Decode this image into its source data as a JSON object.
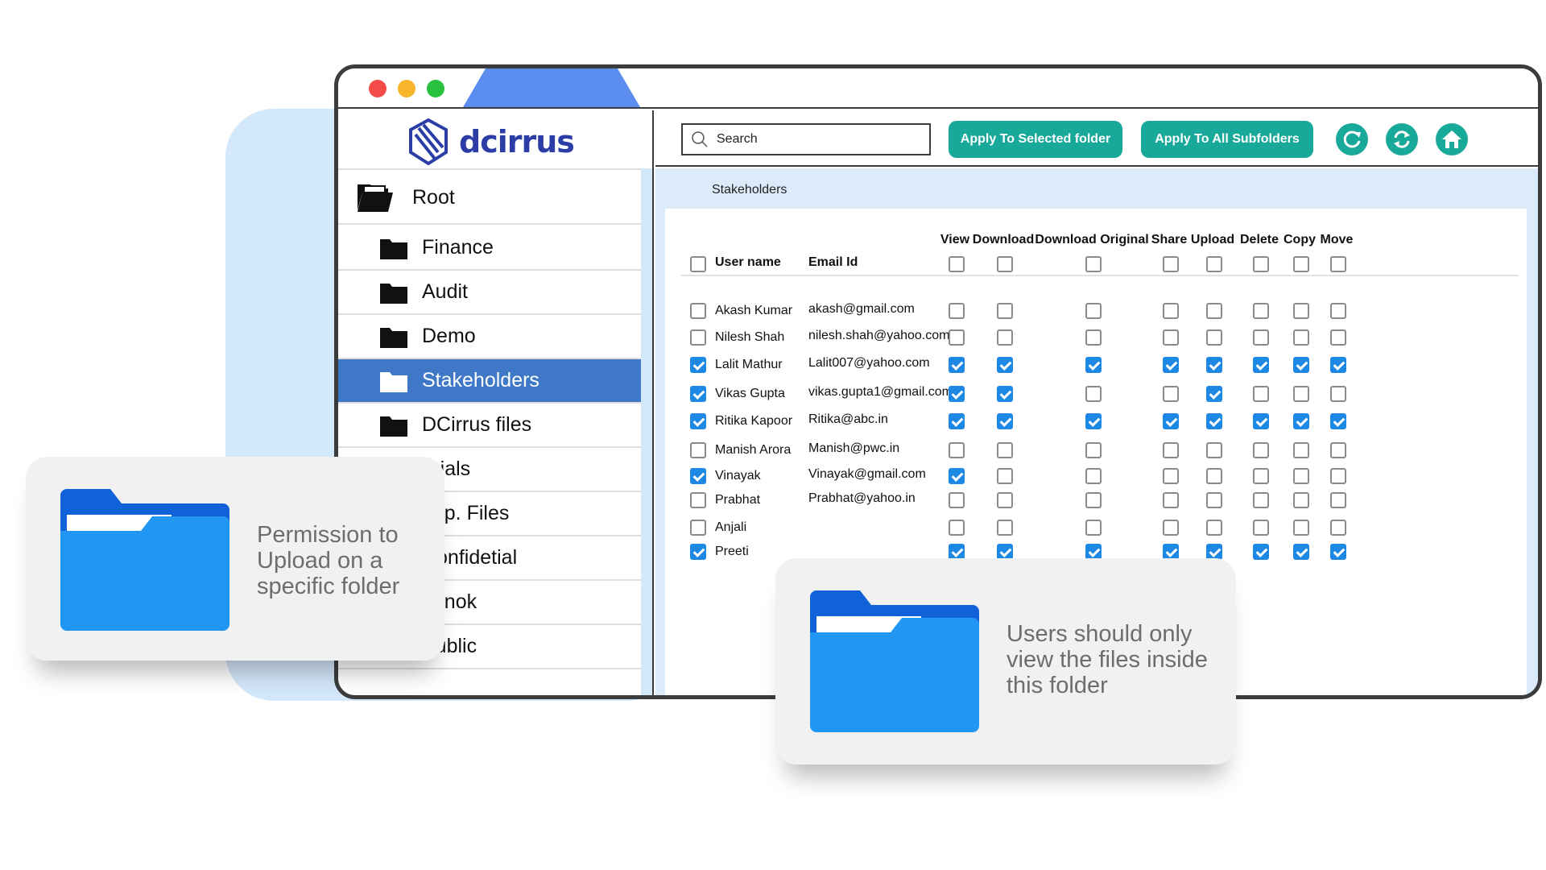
{
  "app": {
    "logo_text": "dcirrus"
  },
  "sidebar": {
    "root_label": "Root",
    "folders": [
      {
        "label": "Finance",
        "active": false
      },
      {
        "label": "Audit",
        "active": false
      },
      {
        "label": "Demo",
        "active": false
      },
      {
        "label": "Stakeholders",
        "active": true
      },
      {
        "label": "DCirrus files",
        "active": false
      },
      {
        "label": "Trials",
        "active": false
      },
      {
        "label": "Imp. Files",
        "active": false
      },
      {
        "label": "Confidetial",
        "active": false
      },
      {
        "label": "Lenok",
        "active": false
      },
      {
        "label": "Public",
        "active": false
      }
    ]
  },
  "toolbar": {
    "search_placeholder": "Search",
    "apply_selected_label": "Apply To Selected folder",
    "apply_all_label": "Apply To All Subfolders",
    "icons": [
      "redo-icon",
      "refresh-icon",
      "home-icon"
    ]
  },
  "breadcrumb": "Stakeholders",
  "table": {
    "col_user": "User name",
    "col_email": "Email Id",
    "permission_headers": [
      "View",
      "Download",
      "Download Original",
      "Share",
      "Upload",
      "Delete",
      "Copy",
      "Move"
    ],
    "rows": [
      {
        "name": "Akash Kumar",
        "email": "akash@gmail.com",
        "selected": false,
        "perms": [
          false,
          false,
          false,
          false,
          false,
          false,
          false,
          false
        ]
      },
      {
        "name": "Nilesh Shah",
        "email": "nilesh.shah@yahoo.com",
        "selected": false,
        "perms": [
          false,
          false,
          false,
          false,
          false,
          false,
          false,
          false
        ]
      },
      {
        "name": "Lalit Mathur",
        "email": "Lalit007@yahoo.com",
        "selected": true,
        "perms": [
          true,
          true,
          true,
          true,
          true,
          true,
          true,
          true
        ]
      },
      {
        "name": "Vikas Gupta",
        "email": "vikas.gupta1@gmail.com",
        "selected": true,
        "perms": [
          true,
          true,
          false,
          false,
          true,
          false,
          false,
          false
        ]
      },
      {
        "name": "Ritika Kapoor",
        "email": "Ritika@abc.in",
        "selected": true,
        "perms": [
          true,
          true,
          true,
          true,
          true,
          true,
          true,
          true
        ]
      },
      {
        "name": "Manish Arora",
        "email": "Manish@pwc.in",
        "selected": false,
        "perms": [
          false,
          false,
          false,
          false,
          false,
          false,
          false,
          false
        ]
      },
      {
        "name": "Vinayak",
        "email": "Vinayak@gmail.com",
        "selected": true,
        "perms": [
          true,
          false,
          false,
          false,
          false,
          false,
          false,
          false
        ]
      },
      {
        "name": "Prabhat",
        "email": "Prabhat@yahoo.in",
        "selected": false,
        "perms": [
          false,
          false,
          false,
          false,
          false,
          false,
          false,
          false
        ]
      },
      {
        "name": "Anjali",
        "email": "",
        "selected": false,
        "perms": [
          false,
          false,
          false,
          false,
          false,
          false,
          false,
          false
        ]
      },
      {
        "name": "Preeti",
        "email": "",
        "selected": true,
        "perms": [
          true,
          true,
          true,
          true,
          true,
          true,
          true,
          true
        ]
      }
    ]
  },
  "callouts": {
    "left": "Permission to Upload on a specific folder",
    "right": "Users should only view the files inside this folder"
  },
  "colors": {
    "accent": "#18a99a",
    "active_folder": "#3f78c6",
    "checkbox": "#1e88e5",
    "folder_icon": "#2196f3",
    "panel_bg": "#dcebfa"
  }
}
